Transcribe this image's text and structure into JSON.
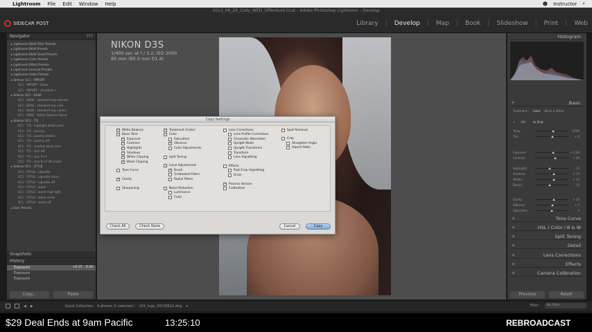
{
  "menubar": {
    "apple": "",
    "app": "Lightroom",
    "items": [
      "File",
      "Edit",
      "Window",
      "Help"
    ],
    "user": "Instructor"
  },
  "window_title": "2013_08_29_Cody_WED_Offenkunt.lrcat - Adobe Photoshop Lightroom - Develop",
  "identity_plate": "SIDECAR POST",
  "modules": [
    "Library",
    "Develop",
    "Map",
    "Book",
    "Slideshow",
    "Print",
    "Web"
  ],
  "active_module": "Develop",
  "left_panel": {
    "navigator_label": "Navigator",
    "navigator_zoom": "FIT",
    "presets": [
      {
        "label": "Lightroom B&W Filter Presets",
        "folder": true
      },
      {
        "label": "Lightroom B&W Presets",
        "folder": true
      },
      {
        "label": "Lightroom B&W Toned Presets",
        "folder": true
      },
      {
        "label": "Lightroom Color Presets",
        "folder": true
      },
      {
        "label": "Lightroom Effect Presets",
        "folder": true
      },
      {
        "label": "Lightroom General Presets",
        "folder": true
      },
      {
        "label": "Lightroom Video Presets",
        "folder": true
      },
      {
        "label": "Sidecar SC1 - IMPORT",
        "folder": true
      },
      {
        "label": "SC1 : IMPORT : blank",
        "folder": false
      },
      {
        "label": "SC1 : IMPORT : standard +",
        "folder": false
      },
      {
        "label": "Sidecar SC2 - BASE",
        "folder": true
      },
      {
        "label": "SC1 : BASE : standard exp warmer",
        "folder": false
      },
      {
        "label": "SC1 : BASE : standard exp cool",
        "folder": false
      },
      {
        "label": "SC1 : BASE : standard exp cooler",
        "folder": false
      },
      {
        "label": "SC1 : BASE : White Balance Reset",
        "folder": false
      },
      {
        "label": "Sidecar SC3 - T/S",
        "folder": true
      },
      {
        "label": "SC1 : T/S : highlight white pane",
        "folder": false
      },
      {
        "label": "SC1 : T/S : punchy",
        "folder": false
      },
      {
        "label": "SC1 : T/S : punchy details",
        "folder": false
      },
      {
        "label": "SC1 : T/S : punchy off",
        "folder": false
      },
      {
        "label": "SC1 : T/S : shadow black core",
        "folder": false
      },
      {
        "label": "SC1 : T/S : skin off",
        "folder": false
      },
      {
        "label": "SC1 : T/S : skin R+Y",
        "folder": false
      },
      {
        "label": "SC1 : T/S : skin R+Y off cream",
        "folder": false
      },
      {
        "label": "Sidecar SC5 - STYLE",
        "folder": true
      },
      {
        "label": "SC1 : STYLE : vignette",
        "folder": false
      },
      {
        "label": "SC1 : STYLE : vignette more",
        "folder": false
      },
      {
        "label": "SC1 : STYLE : vignette off",
        "folder": false
      },
      {
        "label": "SC1 : STYLE : warm",
        "folder": false
      },
      {
        "label": "SC1 : STYLE : warm high light",
        "folder": false
      },
      {
        "label": "SC1 : STYLE : warm more",
        "folder": false
      },
      {
        "label": "SC1 : STYLE : warm off",
        "folder": false
      },
      {
        "label": "User Presets",
        "folder": true
      }
    ],
    "snapshots_label": "Snapshots",
    "history_label": "History",
    "history": [
      {
        "label": "Exposure",
        "a": "+0.15",
        "b": "-0.30",
        "selected": true
      },
      {
        "label": "Exposure",
        "a": "",
        "b": "",
        "selected": false
      },
      {
        "label": "Exposure",
        "a": "",
        "b": "",
        "selected": false
      }
    ],
    "copy_label": "Copy...",
    "paste_label": "Paste"
  },
  "camera_info": {
    "model": "NIKON D3S",
    "exposure": "1/400 sec at f / 3.2, ISO 2000",
    "lens": "85 mm (85.0 mm f/1.4)"
  },
  "dialog": {
    "title": "Copy Settings",
    "col1": [
      {
        "label": "White Balance",
        "state": "on",
        "indent": 0
      },
      {
        "label": "Basic Tone",
        "state": "dash",
        "indent": 0
      },
      {
        "label": "Exposure",
        "state": "on",
        "indent": 1
      },
      {
        "label": "Contrast",
        "state": "on",
        "indent": 1
      },
      {
        "label": "Highlights",
        "state": "on",
        "indent": 1
      },
      {
        "label": "Shadows",
        "state": "on",
        "indent": 1
      },
      {
        "label": "White Clipping",
        "state": "on",
        "indent": 1
      },
      {
        "label": "Black Clipping",
        "state": "on",
        "indent": 1
      },
      {
        "label": "Tone Curve",
        "state": "off",
        "indent": 0
      },
      {
        "label": "Clarity",
        "state": "on",
        "indent": 0
      },
      {
        "label": "Sharpening",
        "state": "off",
        "indent": 0
      }
    ],
    "col2": [
      {
        "label": "Treatment (Color)",
        "state": "on",
        "indent": 0
      },
      {
        "label": "Color",
        "state": "dash",
        "indent": 0
      },
      {
        "label": "Saturation",
        "state": "off",
        "indent": 1
      },
      {
        "label": "Vibrance",
        "state": "on",
        "indent": 1
      },
      {
        "label": "Color Adjustments",
        "state": "off",
        "indent": 1
      },
      {
        "label": "Split Toning",
        "state": "off",
        "indent": 0
      },
      {
        "label": "Local Adjustments",
        "state": "dash",
        "indent": 0
      },
      {
        "label": "Brush",
        "state": "on",
        "indent": 1
      },
      {
        "label": "Graduated Filters",
        "state": "off",
        "indent": 1
      },
      {
        "label": "Radial Filters",
        "state": "off",
        "indent": 1
      },
      {
        "label": "Noise Reduction",
        "state": "off",
        "indent": 0
      },
      {
        "label": "Luminance",
        "state": "off",
        "indent": 1
      },
      {
        "label": "Color",
        "state": "off",
        "indent": 1
      }
    ],
    "col3": [
      {
        "label": "Lens Corrections",
        "state": "off",
        "indent": 0
      },
      {
        "label": "Lens Profile Corrections",
        "state": "off",
        "indent": 1
      },
      {
        "label": "Chromatic Aberration",
        "state": "off",
        "indent": 1
      },
      {
        "label": "Upright Mode",
        "state": "off",
        "indent": 1
      },
      {
        "label": "Upright Transforms",
        "state": "off",
        "indent": 1
      },
      {
        "label": "Transform",
        "state": "off",
        "indent": 1
      },
      {
        "label": "Lens Vignetting",
        "state": "off",
        "indent": 1
      },
      {
        "label": "Effects",
        "state": "off",
        "indent": 0
      },
      {
        "label": "Post-Crop Vignetting",
        "state": "off",
        "indent": 1
      },
      {
        "label": "Grain",
        "state": "off",
        "indent": 1
      },
      {
        "label": "Process Version",
        "state": "on",
        "indent": 0
      },
      {
        "label": "Calibration",
        "state": "off",
        "indent": 0
      }
    ],
    "col4": [
      {
        "label": "Spot Removal",
        "state": "off",
        "indent": 0
      },
      {
        "label": "Crop",
        "state": "off",
        "indent": 0
      },
      {
        "label": "Straighten Angle",
        "state": "off",
        "indent": 1
      },
      {
        "label": "Aspect Ratio",
        "state": "off",
        "indent": 1
      }
    ],
    "check_all": "Check All",
    "check_none": "Check None",
    "cancel": "Cancel",
    "copy": "Copy"
  },
  "right_panel": {
    "histogram_label": "Histogram",
    "basic_label": "Basic",
    "treatment_label": "Treatment :",
    "treatment_color": "Color",
    "treatment_bw": "Black & White",
    "wb_label": "WB :",
    "wb_value": "As Shot",
    "sliders": [
      {
        "label": "Temp",
        "value": "4700",
        "pos": 0.55
      },
      {
        "label": "Tint",
        "value": "+ 6",
        "pos": 0.52
      },
      {
        "label": "Exposure",
        "value": "+ 0.30",
        "pos": 0.55
      },
      {
        "label": "Contrast",
        "value": "+ 20",
        "pos": 0.6
      },
      {
        "label": "Highlights",
        "value": "- 15",
        "pos": 0.44
      },
      {
        "label": "Shadows",
        "value": "+ 15",
        "pos": 0.56
      },
      {
        "label": "Whites",
        "value": "+ 15",
        "pos": 0.56
      },
      {
        "label": "Blacks",
        "value": "- 15",
        "pos": 0.44
      },
      {
        "label": "Clarity",
        "value": "+ 15",
        "pos": 0.56
      },
      {
        "label": "Vibrance",
        "value": "+ 5",
        "pos": 0.53
      },
      {
        "label": "Saturation",
        "value": "0",
        "pos": 0.5
      }
    ],
    "sections": [
      "Tone Curve",
      "HSL / Color / B & W",
      "Split Toning",
      "Detail",
      "Lens Corrections",
      "Effects",
      "Camera Calibration"
    ],
    "previous_label": "Previous",
    "reset_label": "Reset"
  },
  "filmstrip": {
    "source": "Quick Collection",
    "count": "9 photos /1 selected /",
    "filename": "101_ingo_20130622.dng",
    "filter_label": "Filter :",
    "filter_value": "No Filter"
  },
  "footer": {
    "deal": "$29 Deal Ends at 9am Pacific",
    "clock": "13:25:10",
    "rebroadcast": "REBROADCAST"
  }
}
